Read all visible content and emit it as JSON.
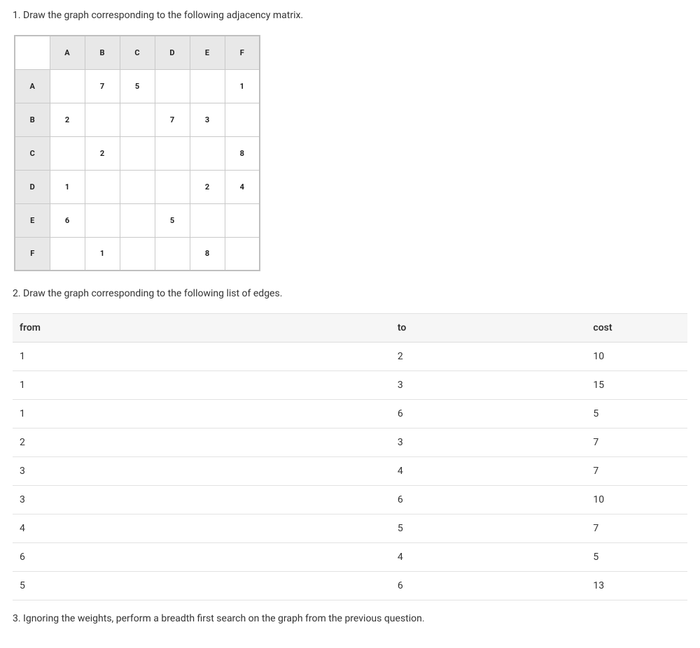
{
  "question1": "1. Draw the graph corresponding to the following adjacency matrix.",
  "adjacency": {
    "headers": [
      "A",
      "B",
      "C",
      "D",
      "E",
      "F"
    ],
    "rows": [
      {
        "label": "A",
        "cells": [
          "",
          "7",
          "5",
          "",
          "",
          "1"
        ]
      },
      {
        "label": "B",
        "cells": [
          "2",
          "",
          "",
          "7",
          "3",
          ""
        ]
      },
      {
        "label": "C",
        "cells": [
          "",
          "2",
          "",
          "",
          "",
          "8"
        ]
      },
      {
        "label": "D",
        "cells": [
          "1",
          "",
          "",
          "",
          "2",
          "4"
        ]
      },
      {
        "label": "E",
        "cells": [
          "6",
          "",
          "",
          "5",
          "",
          ""
        ]
      },
      {
        "label": "F",
        "cells": [
          "",
          "1",
          "",
          "",
          "8",
          ""
        ]
      }
    ]
  },
  "question2": "2. Draw the graph corresponding to the following list of edges.",
  "edges_headers": {
    "from": "from",
    "to": "to",
    "cost": "cost"
  },
  "edges": [
    {
      "from": "1",
      "to": "2",
      "cost": "10"
    },
    {
      "from": "1",
      "to": "3",
      "cost": "15"
    },
    {
      "from": "1",
      "to": "6",
      "cost": "5"
    },
    {
      "from": "2",
      "to": "3",
      "cost": "7"
    },
    {
      "from": "3",
      "to": "4",
      "cost": "7"
    },
    {
      "from": "3",
      "to": "6",
      "cost": "10"
    },
    {
      "from": "4",
      "to": "5",
      "cost": "7"
    },
    {
      "from": "6",
      "to": "4",
      "cost": "5"
    },
    {
      "from": "5",
      "to": "6",
      "cost": "13"
    }
  ],
  "question3": "3. Ignoring the weights, perform a breadth first search on the graph from the previous question."
}
